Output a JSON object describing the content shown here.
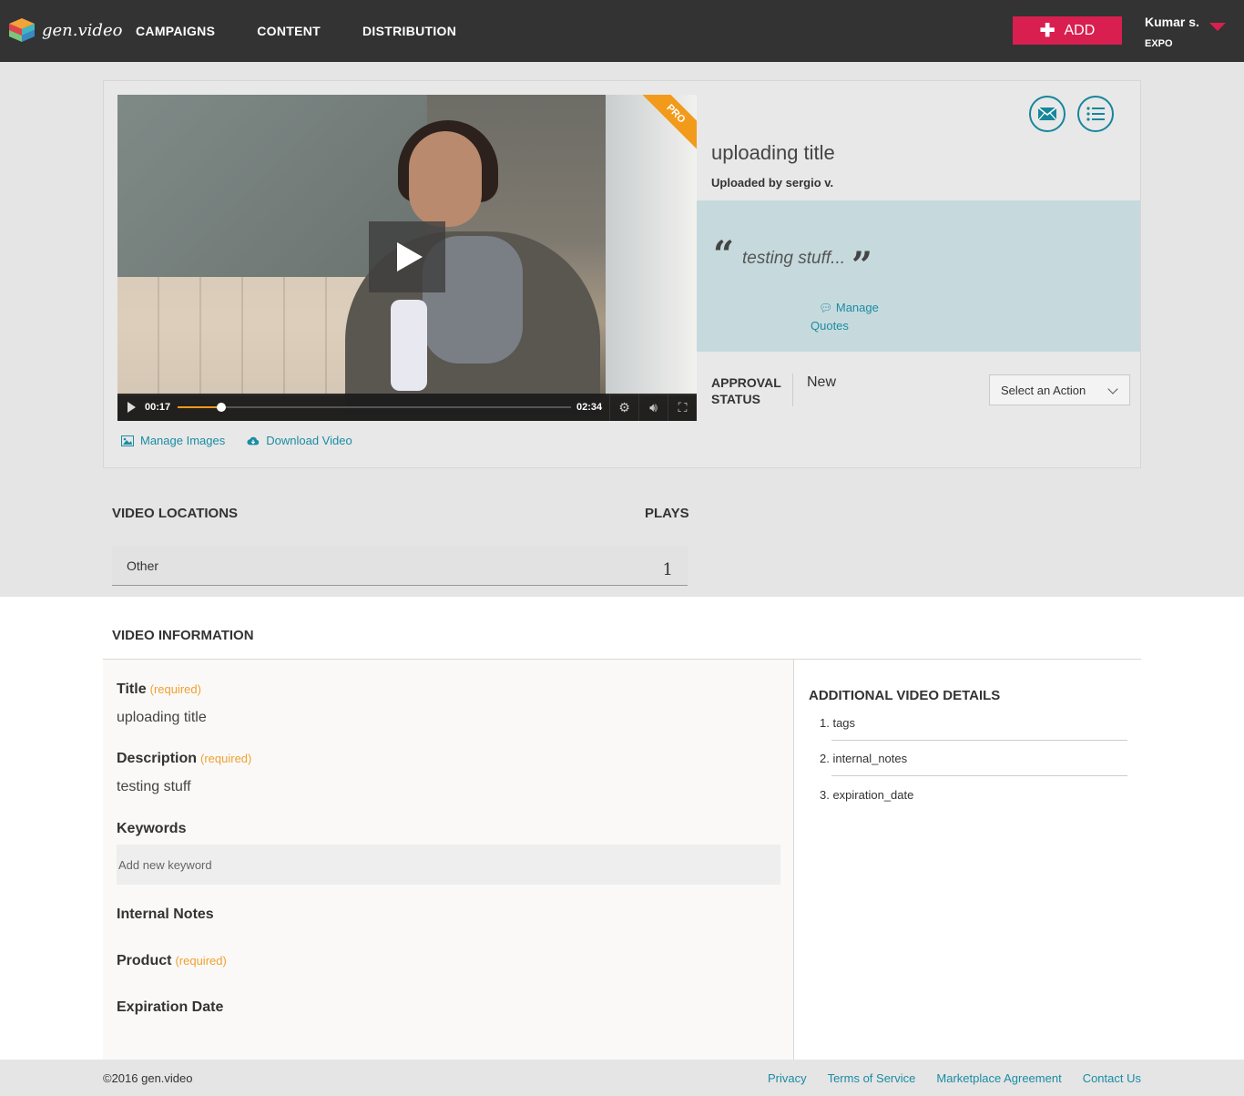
{
  "header": {
    "logo_text": "gen.video",
    "nav": [
      "CAMPAIGNS",
      "CONTENT",
      "DISTRIBUTION"
    ],
    "add_label": "ADD",
    "user_name": "Kumar s.",
    "user_org": "EXPO"
  },
  "video": {
    "badge": "PRO",
    "current_time": "00:17",
    "duration": "02:34",
    "progress_fraction": 0.11,
    "manage_images": "Manage Images",
    "download_video": "Download Video"
  },
  "details": {
    "title": "uploading title",
    "uploaded_by": "Uploaded by sergio v.",
    "quote_open": "“",
    "quote_text": "testing stuff...",
    "quote_close": "”",
    "manage_quotes": "Manage Quotes",
    "approval_label": "APPROVAL STATUS",
    "approval_value": "New",
    "action_select": "Select an Action"
  },
  "locations": {
    "heading": "VIDEO LOCATIONS",
    "plays_heading": "PLAYS",
    "rows": [
      {
        "name": "Other",
        "plays": "1"
      }
    ]
  },
  "info": {
    "heading": "VIDEO INFORMATION",
    "required": "(required)",
    "title_label": "Title",
    "title_value": "uploading title",
    "description_label": "Description",
    "description_value": "testing stuff",
    "keywords_label": "Keywords",
    "keywords_placeholder": "Add new keyword",
    "internal_notes_label": "Internal Notes",
    "product_label": "Product",
    "expiration_label": "Expiration Date"
  },
  "additional": {
    "heading": "ADDITIONAL VIDEO DETAILS",
    "items": [
      "1. tags",
      "2. internal_notes",
      "3. expiration_date"
    ]
  },
  "footer": {
    "copyright": "©2016 gen.video",
    "links": [
      "Privacy",
      "Terms of Service",
      "Marketplace Agreement",
      "Contact Us"
    ]
  },
  "colors": {
    "topbar": "#333333",
    "accent_red": "#d81f4f",
    "link_teal": "#1a8ca3",
    "pro_orange": "#f29a1a",
    "quote_panel": "#c6dadd",
    "required_orange": "#f0a030"
  }
}
